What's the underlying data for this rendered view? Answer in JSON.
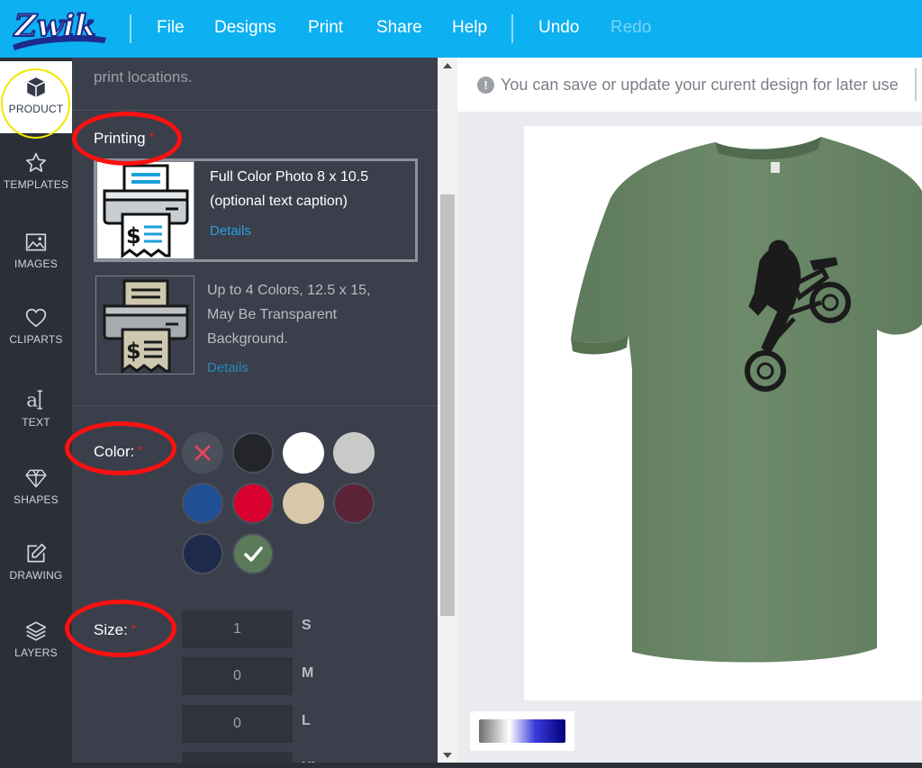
{
  "app": {
    "logo_text": "Zwik",
    "menu": {
      "file": "File",
      "designs": "Designs",
      "print": "Print",
      "share": "Share",
      "help": "Help",
      "undo": "Undo",
      "redo": "Redo"
    }
  },
  "sidebar": {
    "items": [
      {
        "label": "PRODUCT",
        "icon": "cube-icon",
        "active": true
      },
      {
        "label": "TEMPLATES",
        "icon": "star-icon"
      },
      {
        "label": "IMAGES",
        "icon": "image-icon"
      },
      {
        "label": "CLIPARTS",
        "icon": "heart-icon"
      },
      {
        "label": "TEXT",
        "icon": "text-icon"
      },
      {
        "label": "SHAPES",
        "icon": "diamond-icon"
      },
      {
        "label": "DRAWING",
        "icon": "edit-icon"
      },
      {
        "label": "LAYERS",
        "icon": "layers-icon"
      }
    ]
  },
  "panel": {
    "intro_text": "print locations.",
    "printing": {
      "label": "Printing",
      "required_mark": "*",
      "options": [
        {
          "text_line1": "Full Color Photo 8 x 10.5",
          "text_line2": "(optional text caption)",
          "details": "Details",
          "selected": true
        },
        {
          "text_line1": "Up to 4 Colors, 12.5 x 15,",
          "text_line2": "May Be Transparent",
          "text_line3": "Background.",
          "details": "Details",
          "selected": false
        }
      ]
    },
    "color": {
      "label": "Color:",
      "required_mark": "*",
      "swatches": [
        {
          "name": "none",
          "hex": "#4a4f5c"
        },
        {
          "name": "black",
          "hex": "#232529"
        },
        {
          "name": "white",
          "hex": "#ffffff"
        },
        {
          "name": "light-gray",
          "hex": "#c9c9c7"
        },
        {
          "name": "royal-blue",
          "hex": "#1f4f95"
        },
        {
          "name": "red",
          "hex": "#d7002e"
        },
        {
          "name": "tan",
          "hex": "#d9c7aa"
        },
        {
          "name": "maroon",
          "hex": "#5c2337"
        },
        {
          "name": "navy",
          "hex": "#1d2a49"
        },
        {
          "name": "military-green",
          "hex": "#5a7a5a",
          "selected": true
        }
      ]
    },
    "size": {
      "label": "Size:",
      "required_mark": "*",
      "rows": [
        {
          "qty": "1",
          "size": "S"
        },
        {
          "qty": "0",
          "size": "M"
        },
        {
          "qty": "0",
          "size": "L"
        },
        {
          "qty": "",
          "size": "XL"
        }
      ]
    }
  },
  "canvas": {
    "notice": "You can save or update your curent design for later use",
    "product_color": "#6a8467"
  },
  "colors": {
    "topbar": "#0db0f0",
    "sidebar": "#2b2f38",
    "panel": "#3a3f4b",
    "annotation_red": "#ff1010",
    "annotation_yellow": "#f3e600"
  }
}
